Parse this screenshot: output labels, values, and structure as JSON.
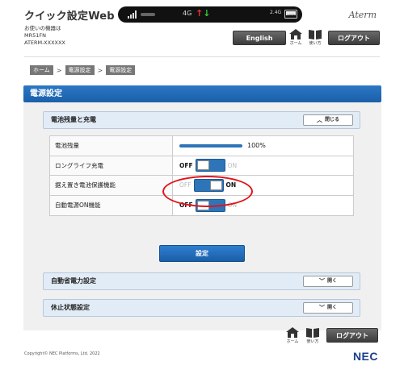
{
  "header": {
    "app_title": "クイック設定Web",
    "device_lines": [
      "お使いの機器は",
      "MR51FN",
      "ATERM-XXXXXX"
    ],
    "brand": "Aterm",
    "status_bar": {
      "network": "4G",
      "clock": "2.4G",
      "battery_label": "100%"
    },
    "language_button": "English",
    "home_label": "ホーム",
    "manual_label": "使い方",
    "logout_button": "ログアウト"
  },
  "breadcrumb": [
    "ホーム",
    "電源設定",
    "電源設定"
  ],
  "breadcrumb_sep": ">",
  "section_title": "電源設定",
  "battery_panel": {
    "title": "電池残量と充電",
    "toggle_label": "閉じる",
    "rows": [
      {
        "label": "電池残量",
        "type": "battery",
        "value": "100%",
        "fill": 1.0
      },
      {
        "label": "ロングライフ充電",
        "type": "switch",
        "off": "OFF",
        "on": "ON",
        "state": "off"
      },
      {
        "label": "据え置き電池保護機能",
        "type": "switch",
        "off": "OFF",
        "on": "ON",
        "state": "on"
      },
      {
        "label": "自動電源ON機能",
        "type": "switch",
        "off": "OFF",
        "on": "ON",
        "state": "off"
      }
    ]
  },
  "submit_button": "設定",
  "power_save_panel": {
    "title": "自動省電力設定",
    "toggle_label": "開く"
  },
  "sleep_panel": {
    "title": "休止状態設定",
    "toggle_label": "開く"
  },
  "footer": {
    "home_label": "ホーム",
    "manual_label": "使い方",
    "logout_button": "ログアウト",
    "copyright": "Copyright© NEC Platforms, Ltd. 2022",
    "logo": "NEC"
  },
  "colors": {
    "accent_blue": "#1b5fa8",
    "highlight_red": "#e0141b",
    "dark_button": "#3c3c3c"
  }
}
